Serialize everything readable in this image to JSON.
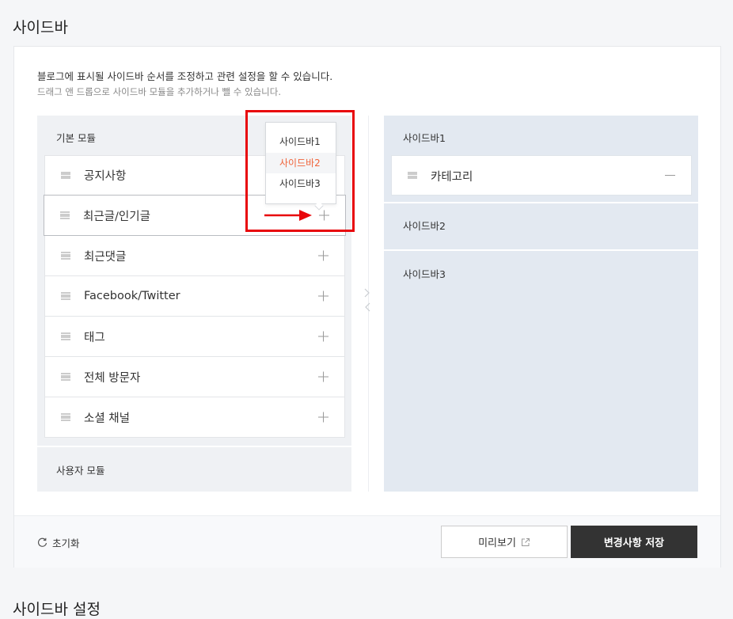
{
  "page": {
    "title": "사이드바",
    "bottom_title": "사이드바 설정"
  },
  "description": {
    "line1": "블로그에 표시될 사이드바 순서를 조정하고 관련 설정을 할 수 있습니다.",
    "line2": "드래그 앤 드롭으로 사이드바 모듈을 추가하거나 뺄 수 있습니다."
  },
  "basic_modules": {
    "heading": "기본 모듈",
    "items": [
      {
        "label": "공지사항"
      },
      {
        "label": "최근글/인기글"
      },
      {
        "label": "최근댓글"
      },
      {
        "label": "Facebook/Twitter"
      },
      {
        "label": "태그"
      },
      {
        "label": "전체 방문자"
      },
      {
        "label": "소셜 채널"
      }
    ]
  },
  "user_modules": {
    "heading": "사용자 모듈"
  },
  "sidebars": [
    {
      "title": "사이드바1",
      "items": [
        {
          "label": "카테고리"
        }
      ]
    },
    {
      "title": "사이드바2",
      "items": []
    },
    {
      "title": "사이드바3",
      "items": []
    }
  ],
  "dropdown": {
    "options": [
      "사이드바1",
      "사이드바2",
      "사이드바3"
    ],
    "highlighted": "사이드바2"
  },
  "footer": {
    "reset_label": "초기화",
    "preview_label": "미리보기",
    "save_label": "변경사항 저장"
  },
  "colors": {
    "accent": "#f0643b",
    "annotation_red": "#e8060b",
    "save_button": "#333333",
    "sidebar_bg": "#e3e9f1"
  }
}
